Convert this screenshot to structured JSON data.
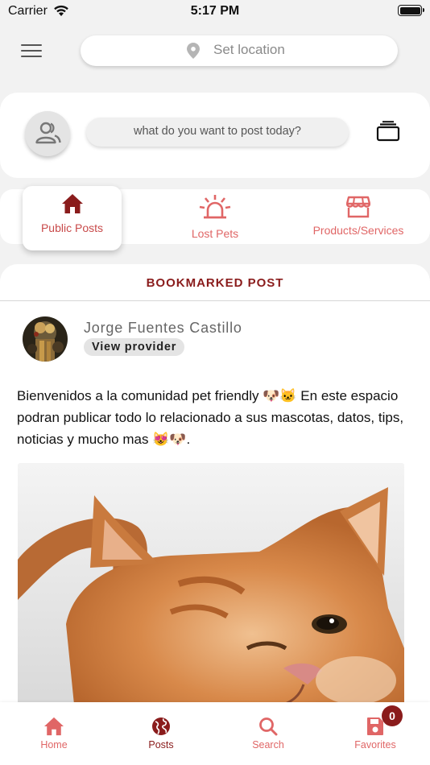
{
  "status_bar": {
    "carrier": "Carrier",
    "time": "5:17 PM"
  },
  "top_bar": {
    "location_placeholder": "Set location"
  },
  "composer": {
    "placeholder": "what do you want to post today?"
  },
  "tabs": [
    {
      "label": "Public Posts",
      "icon": "home-icon",
      "active": true
    },
    {
      "label": "Lost Pets",
      "icon": "siren-icon",
      "active": false
    },
    {
      "label": "Products/Services",
      "icon": "store-icon",
      "active": false
    }
  ],
  "section": {
    "title": "BOOKMARKED POST"
  },
  "post": {
    "author": "Jorge Fuentes Castillo",
    "provider_button": "View provider",
    "text": "Bienvenidos a la comunidad pet friendly 🐶🐱 En este espacio podran publicar todo lo relacionado a sus mascotas, datos, tips, noticias y mucho mas 😻🐶."
  },
  "bottom_nav": {
    "items": [
      {
        "label": "Home",
        "icon": "home-icon"
      },
      {
        "label": "Posts",
        "icon": "globe-icon",
        "active": true
      },
      {
        "label": "Search",
        "icon": "search-icon"
      },
      {
        "label": "Favorites",
        "icon": "save-icon"
      }
    ],
    "favorites_count": "0"
  },
  "colors": {
    "accent": "#e06666",
    "brand": "#8a1c1c"
  }
}
